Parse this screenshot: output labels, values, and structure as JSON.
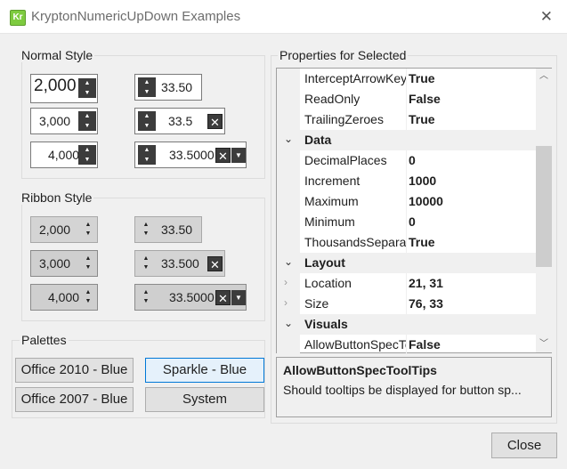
{
  "window": {
    "title": "KryptonNumericUpDown Examples",
    "icon_text": "Kr",
    "close_glyph": "✕"
  },
  "groups": {
    "normal": "Normal Style",
    "ribbon": "Ribbon Style",
    "palettes": "Palettes",
    "properties": "Properties for Selected"
  },
  "normal": {
    "left": [
      "2,000",
      "3,000",
      "4,000"
    ],
    "right": [
      "33.50",
      "33.5",
      "33.5000"
    ]
  },
  "ribbon": {
    "left": [
      "2,000",
      "3,000",
      "4,000"
    ],
    "right": [
      "33.50",
      "33.500",
      "33.5000"
    ]
  },
  "palettes": {
    "buttons": [
      "Office 2010 - Blue",
      "Sparkle - Blue",
      "Office 2007 - Blue",
      "System"
    ],
    "selected": "Sparkle - Blue"
  },
  "properties": {
    "rows": [
      {
        "type": "prop",
        "name": "InterceptArrowKeys",
        "value": "True"
      },
      {
        "type": "prop",
        "name": "ReadOnly",
        "value": "False"
      },
      {
        "type": "prop",
        "name": "TrailingZeroes",
        "value": "True"
      },
      {
        "type": "cat",
        "name": "Data"
      },
      {
        "type": "prop",
        "name": "DecimalPlaces",
        "value": "0"
      },
      {
        "type": "prop",
        "name": "Increment",
        "value": "1000"
      },
      {
        "type": "prop",
        "name": "Maximum",
        "value": "10000"
      },
      {
        "type": "prop",
        "name": "Minimum",
        "value": "0"
      },
      {
        "type": "prop",
        "name": "ThousandsSeparator",
        "value": "True"
      },
      {
        "type": "cat",
        "name": "Layout"
      },
      {
        "type": "expandable",
        "name": "Location",
        "value": "21, 31"
      },
      {
        "type": "expandable",
        "name": "Size",
        "value": "76, 33"
      },
      {
        "type": "cat",
        "name": "Visuals"
      },
      {
        "type": "prop",
        "name": "AllowButtonSpecToolTips",
        "value": "False"
      }
    ]
  },
  "description": {
    "title": "AllowButtonSpecToolTips",
    "text": "Should tooltips be displayed for button sp..."
  },
  "buttons": {
    "close": "Close"
  },
  "icons": {
    "spin_up": "▲",
    "spin_down": "▼",
    "clear": "✕",
    "dropdown": "▼",
    "expand": "⌄",
    "collapsed": "›",
    "scroll_up": "︿",
    "scroll_down": "﹀"
  }
}
